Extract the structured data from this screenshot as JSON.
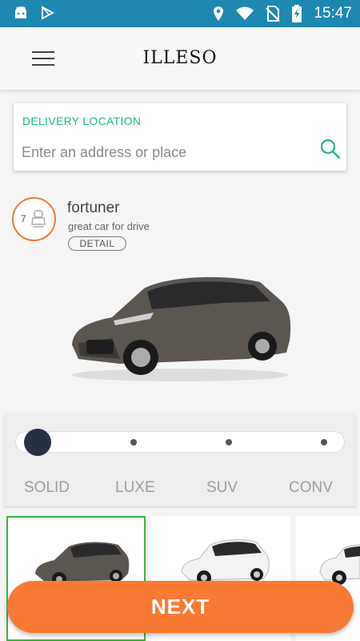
{
  "status_bar": {
    "time": "15:47",
    "icons": [
      "android-icon",
      "play-store-icon",
      "location-icon",
      "wifi-icon",
      "no-sim-icon",
      "battery-charging-icon"
    ]
  },
  "app_bar": {
    "title": "ILLESO",
    "menu_icon": "hamburger-menu-icon"
  },
  "delivery": {
    "label": "DELIVERY LOCATION",
    "placeholder": "Enter an address or place",
    "value": "",
    "search_icon": "search-icon"
  },
  "car": {
    "seats": "7",
    "seat_icon": "car-seat-icon",
    "name": "fortuner",
    "description": "great car for drive",
    "detail_label": "DETAIL"
  },
  "categories": {
    "items": [
      "SOLID",
      "LUXE",
      "SUV",
      "CONV"
    ],
    "selected": "SOLID"
  },
  "thumbnails": [
    {
      "name": "grey-sedan",
      "selected": true
    },
    {
      "name": "white-hatchback",
      "selected": false
    },
    {
      "name": "white-suv",
      "selected": false
    }
  ],
  "colors": {
    "status_bar": "#1e88b0",
    "accent_green": "#1bb886",
    "orange": "#f97a34",
    "slider_knob": "#283046",
    "selected_border": "#3bb33b"
  },
  "next_label": "NEXT"
}
